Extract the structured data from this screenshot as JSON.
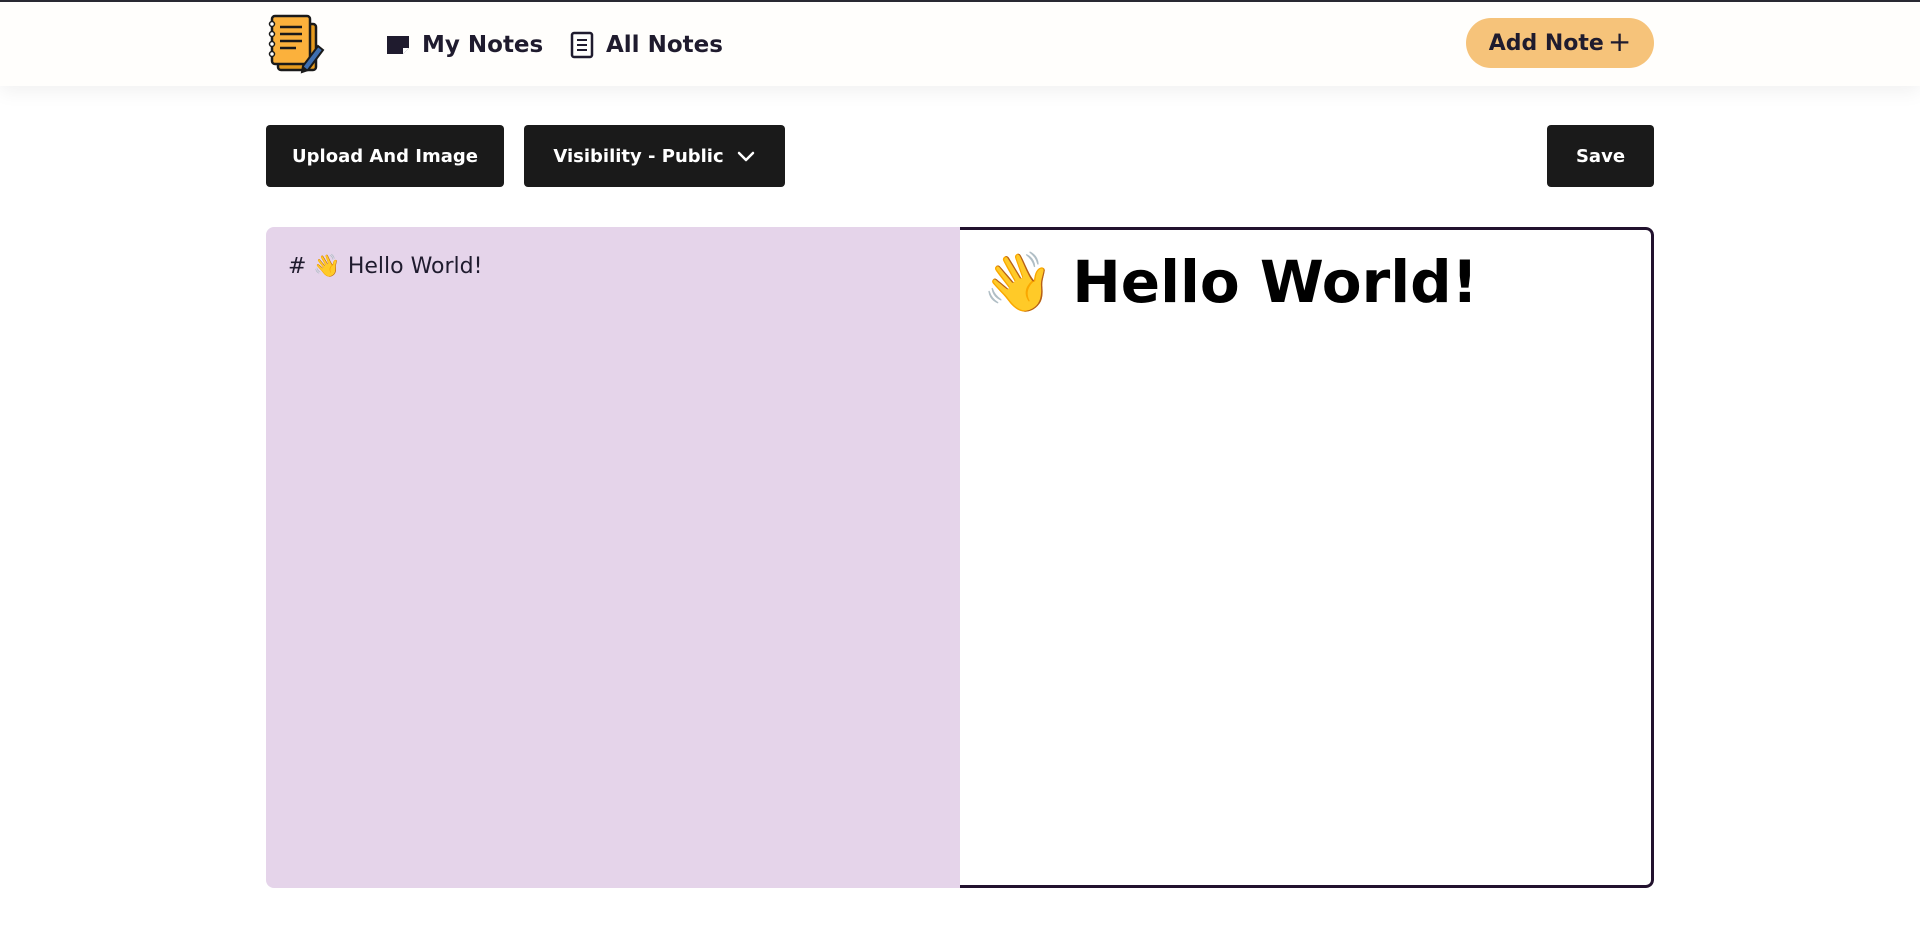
{
  "nav": {
    "logo_icon": "notebook-pencil-logo",
    "links": [
      {
        "label": "My Notes",
        "icon": "note-icon"
      },
      {
        "label": "All Notes",
        "icon": "document-icon"
      }
    ],
    "add_note_label": "Add Note",
    "add_note_icon": "+"
  },
  "toolbar": {
    "upload_label": "Upload And Image",
    "visibility_label": "Visibility - Public",
    "save_label": "Save"
  },
  "editor": {
    "source_text": "# 👋 Hello World!",
    "preview_emoji": "👋",
    "preview_heading": "Hello World!"
  },
  "colors": {
    "accent": "#f6c37a",
    "editor_bg": "#e5d4ea",
    "button_bg": "#1a1a1a"
  }
}
